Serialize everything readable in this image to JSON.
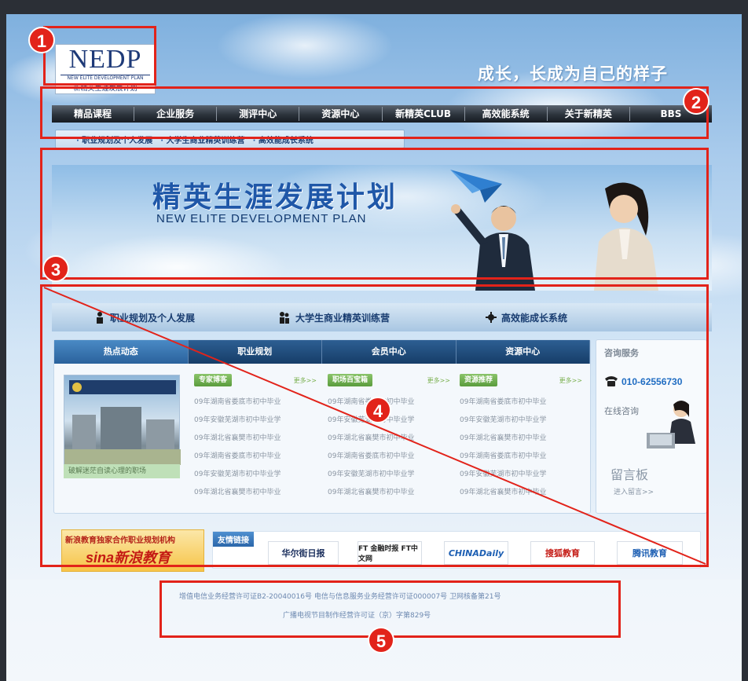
{
  "header": {
    "logo_text": "NEDP",
    "logo_sub1": "NEW ELITE DEVELOPMENT PLAN",
    "logo_sub2": "新精英生涯发展计划",
    "slogan": "成长，长成为自己的样子"
  },
  "nav": {
    "items": [
      "精品课程",
      "企业服务",
      "测评中心",
      "资源中心",
      "新精英CLUB",
      "高效能系统",
      "关于新精英",
      "BBS"
    ]
  },
  "subnav": {
    "items": [
      "职业规划及个人发展",
      "大学生商业精英训练营",
      "高效能成长系统"
    ]
  },
  "banner": {
    "title": "精英生涯发展计划",
    "subtitle": "NEW ELITE DEVELOPMENT PLAN"
  },
  "quick_links": {
    "items": [
      "职业规划及个人发展",
      "大学生商业精英训练营",
      "高效能成长系统"
    ]
  },
  "tabs": {
    "items": [
      "热点动态",
      "职业规划",
      "会员中心",
      "资源中心"
    ]
  },
  "feature": {
    "caption": "破解迷茫自读心理的职场"
  },
  "columns": [
    {
      "title": "专家博客",
      "more": "更多>>",
      "items": [
        "09年湖南省娄底市初中毕业",
        "09年安徽芜湖市初中毕业学",
        "09年湖北省襄樊市初中毕业",
        "09年湖南省娄底市初中毕业",
        "09年安徽芜湖市初中毕业学",
        "09年湖北省襄樊市初中毕业"
      ]
    },
    {
      "title": "职场百宝箱",
      "more": "更多>>",
      "items": [
        "09年湖南省娄底市初中毕业",
        "09年安徽芜湖市初中毕业学",
        "09年湖北省襄樊市初中毕业",
        "09年湖南省娄底市初中毕业",
        "09年安徽芜湖市初中毕业学",
        "09年湖北省襄樊市初中毕业"
      ]
    },
    {
      "title": "资源推荐",
      "more": "更多>>",
      "items": [
        "09年湖南省娄底市初中毕业",
        "09年安徽芜湖市初中毕业学",
        "09年湖北省襄樊市初中毕业",
        "09年湖南省娄底市初中毕业",
        "09年安徽芜湖市初中毕业学",
        "09年湖北省襄樊市初中毕业"
      ]
    }
  ],
  "service": {
    "title": "咨询服务",
    "phone": "010-62556730",
    "online": "在线咨询",
    "board": "留言板",
    "board_link": "进入留言>>"
  },
  "partners": {
    "sina_line1": "新浪教育独家合作职业规划机构",
    "sina_line2": "sina新浪教育",
    "label": "友情链接",
    "logos": [
      "华尔街日报",
      "FT 金融时报 FT中文网",
      "CHINADaily",
      "搜狐教育",
      "腾讯教育"
    ]
  },
  "footer": {
    "line1": "增值电信业务经营许可证B2-20040016号    电信与信息服务业务经营许可证000007号    卫网核备第21号",
    "line2": "广播电视节目制作经营许可证（京）字第829号"
  },
  "markers": [
    "1",
    "2",
    "3",
    "4",
    "5"
  ],
  "colors": {
    "annotation_red": "#e2231a",
    "nav_dark": "#1b2129",
    "link_blue": "#1f6cc2",
    "accent_green": "#6aa847"
  }
}
